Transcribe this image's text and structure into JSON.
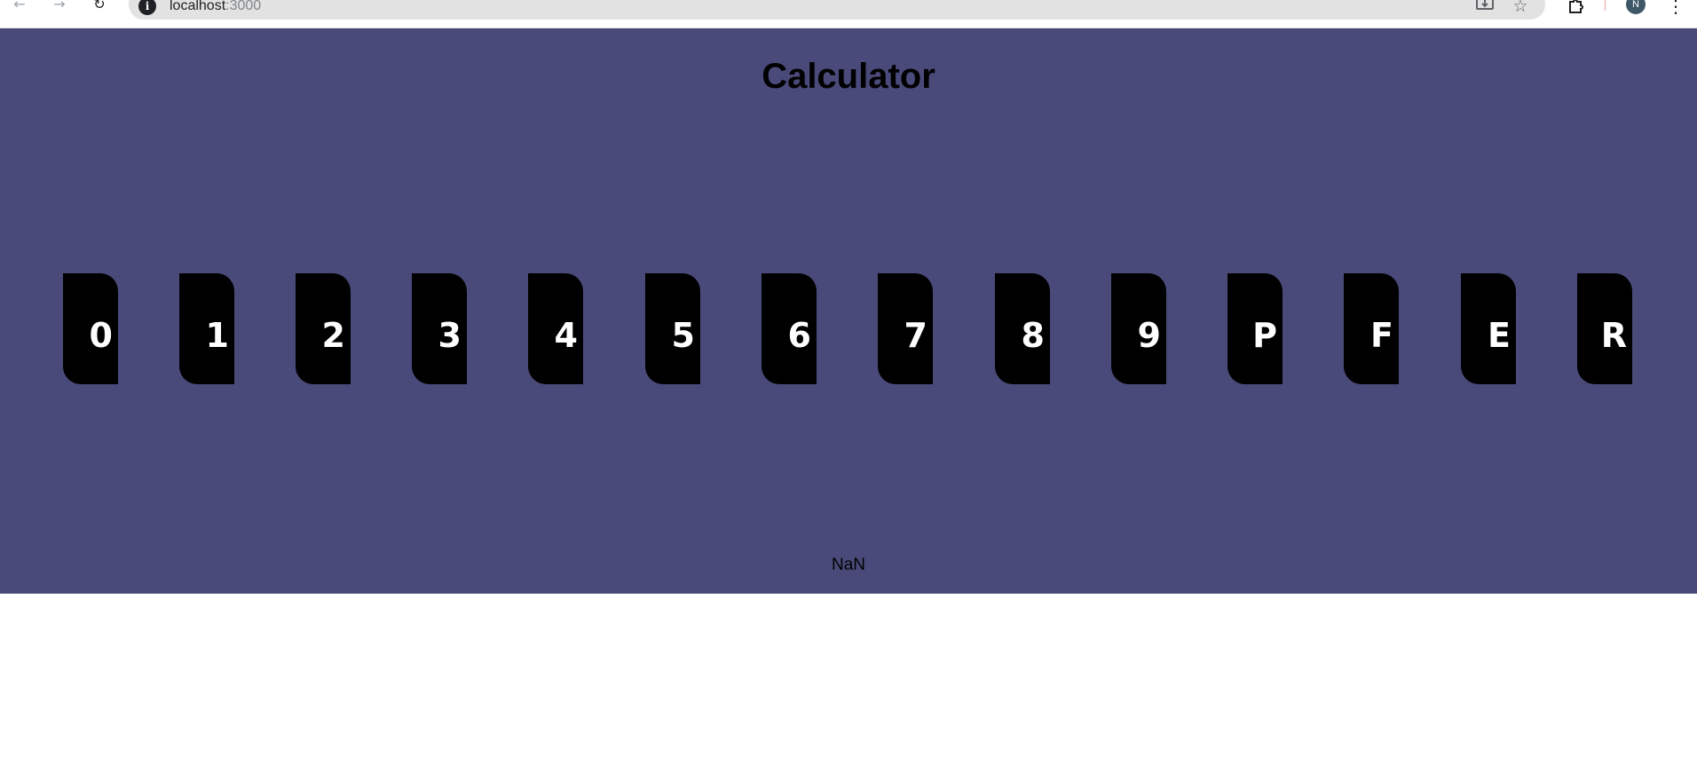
{
  "browser": {
    "url_host": "localhost",
    "url_port": ":3000",
    "avatar_initial": "N",
    "icons": {
      "back": "back-arrow-icon",
      "forward": "forward-arrow-icon",
      "reload": "reload-icon",
      "site_info": "info-icon",
      "install": "install-app-icon",
      "bookmark": "star-icon",
      "extensions": "puzzle-icon",
      "menu": "kebab-menu-icon"
    }
  },
  "app": {
    "background_color": "#4a4a7a",
    "title": "Calculator",
    "result": "NaN",
    "keys": [
      "0",
      "1",
      "2",
      "3",
      "4",
      "5",
      "6",
      "7",
      "8",
      "9",
      "P",
      "F",
      "E",
      "R"
    ]
  }
}
